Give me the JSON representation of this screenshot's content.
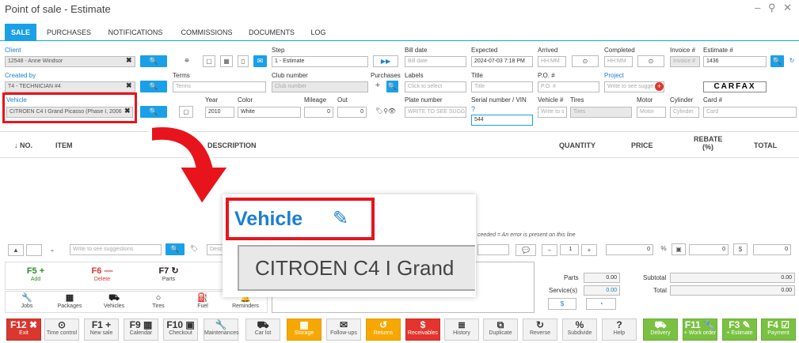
{
  "window": {
    "title": "Point of sale - Estimate",
    "controls": "– ⚲ ✕"
  },
  "tabs": [
    "SALE",
    "PURCHASES",
    "NOTIFICATIONS",
    "COMMISSIONS",
    "DOCUMENTS",
    "LOG"
  ],
  "fields": {
    "client_label": "Client",
    "client_value": "12548 - Anne Windsor",
    "created_by_label": "Created by",
    "created_by_value": "T4 - TECHNICIAN #4",
    "vehicle_label": "Vehicle",
    "vehicle_value": "CITROEN C4 I Grand Picasso (Phase I, 2006",
    "step_label": "Step",
    "step_value": "1 - Estimate",
    "terms_label": "Terms",
    "terms_ph": "Terms",
    "year_label": "Year",
    "year_value": "2010",
    "color_label": "Color",
    "color_value": "White",
    "mileage_label": "Mileage",
    "mileage_value": "0",
    "out_label": "Out",
    "out_value": "0",
    "club_label": "Club number",
    "club_ph": "Club number",
    "purchases_label": "Purchases",
    "bill_date_label": "Bill date",
    "bill_date_ph": "Bill date",
    "labels_label": "Labels",
    "labels_ph": "Click to select",
    "plate_label": "Plate number",
    "plate_ph": "WRITE TO SEE SUGGE",
    "expected_label": "Expected",
    "expected_value": "2024-07-03 7:18 PM",
    "title_label": "Title",
    "title_ph": "Title",
    "serial_label": "Serial number / VIN",
    "serial_value": "544",
    "arrived_label": "Arrived",
    "arrived_ph": "HH:MM",
    "po_label": "P.O. #",
    "po_ph": "P.O. #",
    "vehicle_no_label": "Vehicle #",
    "vehicle_no_ph": "Write to s",
    "tires_label": "Tires",
    "tires_ph": "Tires",
    "completed_label": "Completed",
    "completed_ph": "HH:MM",
    "project_label": "Project",
    "project_ph": "Write to see sugge",
    "motor_label": "Motor",
    "motor_ph": "Motor",
    "cylinder_label": "Cylinder",
    "cylinder_ph": "Cylinder",
    "invoice_label": "Invoice #",
    "invoice_ph": "Invoice #",
    "estimate_label": "Estimate #",
    "estimate_value": "1436",
    "card_label": "Card #",
    "card_ph": "Card",
    "carfax": "CARFAX"
  },
  "grid_headers": {
    "no": "↓ NO.",
    "item": "ITEM",
    "description": "DESCRIPTION",
    "quantity": "QUANTITY",
    "price": "PRICE",
    "rebate": "REBATE (%)",
    "total": "TOTAL"
  },
  "legend_text": "ceeded  = An error is present on this line",
  "entry": {
    "suggest_ph": "Write to see suggestions",
    "desc_ph": "Desc",
    "qty": "1",
    "val0": "0",
    "val1": "0",
    "val2": "0"
  },
  "zoom_vehicle_label": "Vehicle",
  "zoom_vehicle_value": "CITROEN C4 I Grand",
  "shortcuts": [
    {
      "key": "F5 +",
      "label": "Add"
    },
    {
      "key": "F6 —",
      "label": "Delete"
    },
    {
      "key": "F7 ↻",
      "label": "Parts"
    }
  ],
  "quick": [
    "Jobs",
    "Packages",
    "Vehicles",
    "Tires",
    "Fuel",
    "Reminders"
  ],
  "totals": {
    "parts_label": "Parts",
    "parts_value": "0.00",
    "services_label": "Service(s)",
    "services_value": "0.00",
    "subtotal_label": "Subtotal",
    "subtotal_value": "0.00",
    "total_label": "Total",
    "total_value": "0.00"
  },
  "fkeys": [
    {
      "key": "F12 ✖",
      "label": "Exit"
    },
    {
      "key": "⊙",
      "label": "Time control"
    },
    {
      "key": "F1 +",
      "label": "New sale"
    },
    {
      "key": "F9 ▦",
      "label": "Calendar"
    },
    {
      "key": "F10 ▣",
      "label": "Checkout"
    },
    {
      "key": "🔧",
      "label": "Maintenances"
    },
    {
      "key": "⛟",
      "label": "Car lot"
    },
    {
      "key": "▦",
      "label": "Storage"
    },
    {
      "key": "✉",
      "label": "Follow-ups"
    },
    {
      "key": "↺",
      "label": "Returns"
    },
    {
      "key": "$",
      "label": "Receivables"
    },
    {
      "key": "≣",
      "label": "History"
    },
    {
      "key": "⧉",
      "label": "Duplicate"
    },
    {
      "key": "↻",
      "label": "Reverse"
    },
    {
      "key": "%",
      "label": "Subdivide"
    },
    {
      "key": "?",
      "label": "Help"
    },
    {
      "key": "⛟",
      "label": "Delivery"
    },
    {
      "key": "F11 🔧",
      "label": "+ Work order"
    },
    {
      "key": "F3 ✎",
      "label": "+ Estimate"
    },
    {
      "key": "F4 ☑",
      "label": "Payment"
    }
  ],
  "colors": {
    "accent": "#1aa0e8",
    "highlight": "#e8141c",
    "storage": "#f7a800",
    "exit": "#d9372f",
    "green": "#7ac142"
  }
}
